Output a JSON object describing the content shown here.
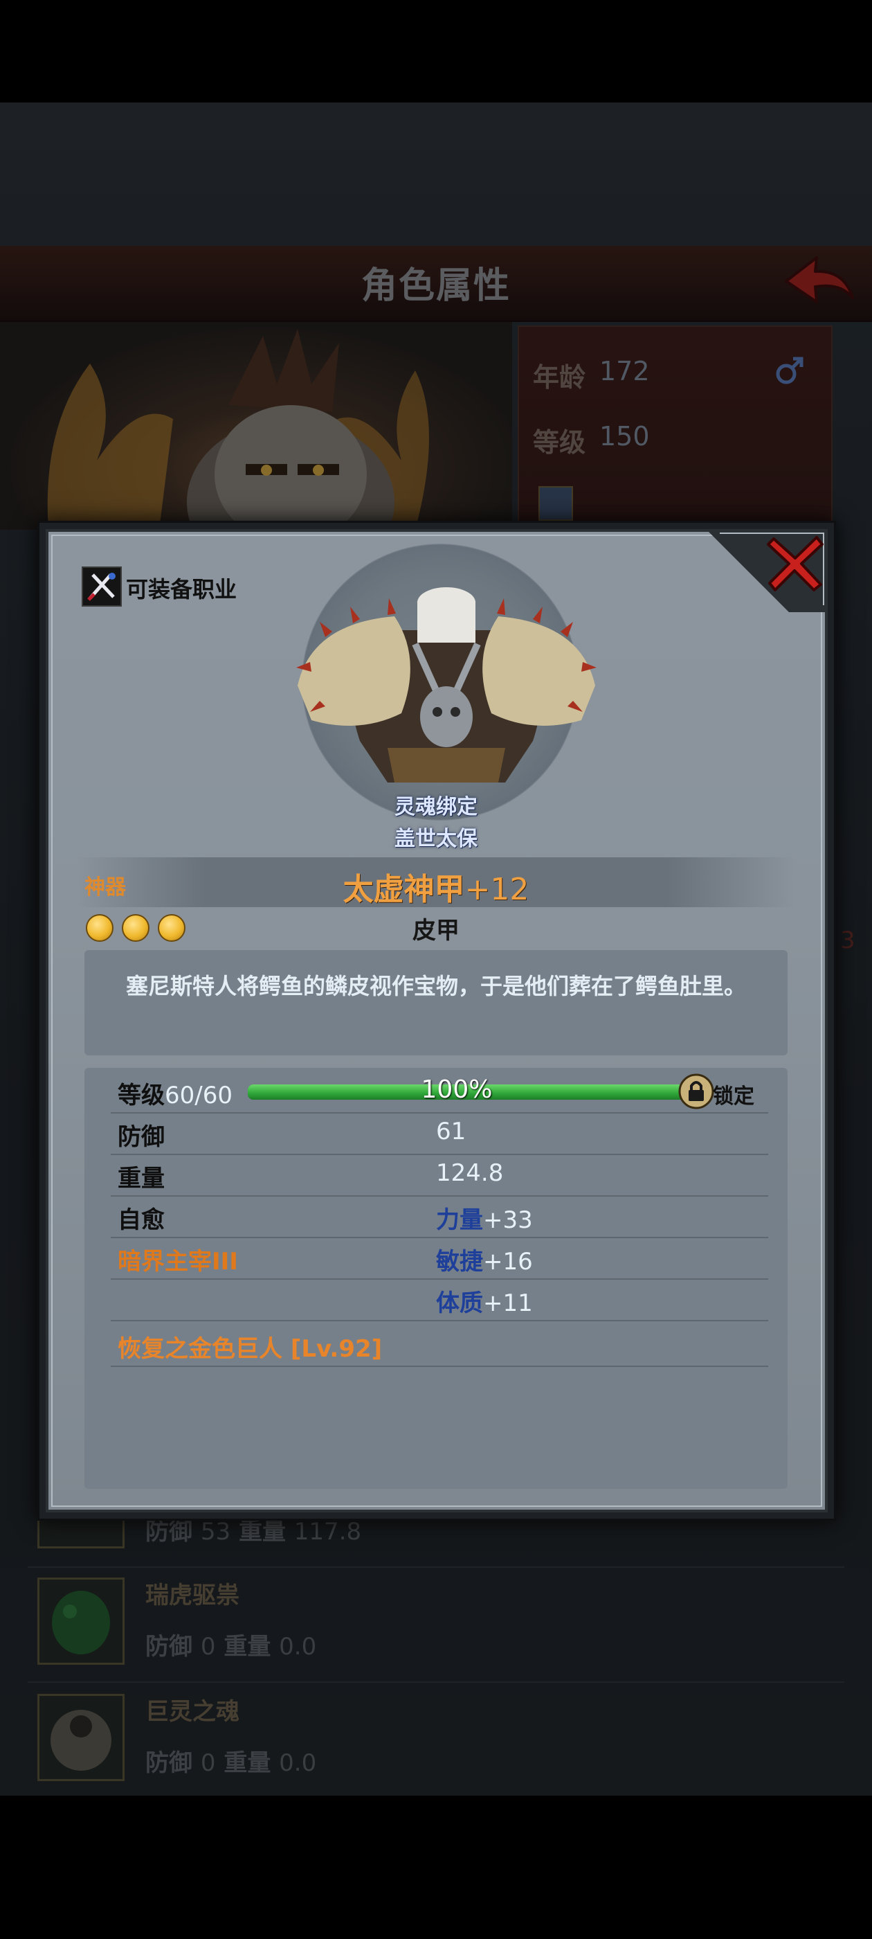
{
  "background": {
    "title": "角色属性",
    "profile": {
      "age_label": "年龄",
      "age_value": "172",
      "level_label": "等级",
      "level_value": "150"
    },
    "side_number": "3",
    "items": [
      {
        "name": "",
        "defense_label": "防御",
        "defense_value": "53",
        "weight_label": "重量",
        "weight_value": "117.8"
      },
      {
        "name": "瑞虎驱祟",
        "defense_label": "防御",
        "defense_value": "0",
        "weight_label": "重量",
        "weight_value": "0.0"
      },
      {
        "name": "巨灵之魂",
        "defense_label": "防御",
        "defense_value": "0",
        "weight_label": "重量",
        "weight_value": "0.0"
      }
    ]
  },
  "modal": {
    "class_label": "可装备职业",
    "bind_status": "灵魂绑定",
    "owner_name": "盖世太保",
    "rarity": "神器",
    "item_name": "太虚神甲",
    "item_plus": "+12",
    "item_type": "皮甲",
    "stars": 3,
    "description": "塞尼斯特人将鳄鱼的鳞皮视作宝物，于是他们葬在了鳄鱼肚里。",
    "level": {
      "label": "等级",
      "value": "60/60",
      "progress_percent": 100,
      "percent_text": "100%",
      "lock_label": "锁定"
    },
    "stats": {
      "defense_label": "防御",
      "defense_value": "61",
      "weight_label": "重量",
      "weight_value": "124.8",
      "self_heal_label": "自愈",
      "dark_lord_label": "暗界主宰III",
      "bonus": [
        {
          "label": "力量",
          "value": "+33"
        },
        {
          "label": "敏捷",
          "value": "+16"
        },
        {
          "label": "体质",
          "value": "+11"
        }
      ],
      "set_bonus": "恢复之金色巨人 [Lv.92]"
    }
  },
  "colors": {
    "artifact_orange": "#f0a040",
    "bonus_blue": "#1e3f9a",
    "bar_green": "#2ea638",
    "close_red": "#c8201c"
  }
}
